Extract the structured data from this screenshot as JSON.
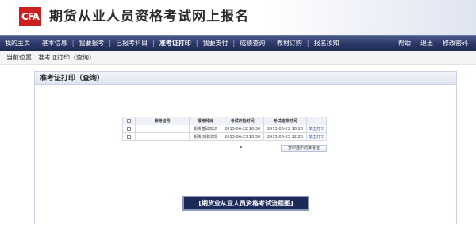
{
  "header": {
    "logo_text": "CFA",
    "title": "期货从业人员资格考试网上报名"
  },
  "nav": {
    "left": [
      "我的主页",
      "基本信息",
      "我要报考",
      "已报考科目",
      "准考证打印",
      "我要支付",
      "成绩查询",
      "教材订购",
      "报名须知"
    ],
    "active_index": 4,
    "right": [
      "帮助",
      "退出",
      "修改密码"
    ]
  },
  "breadcrumb": "当前位置：准考证打印（查询）",
  "panel": {
    "title": "准考证打印（查询）",
    "table": {
      "headers": [
        "",
        "准考证号",
        "报考科目",
        "考试开始时间",
        "考试结束时间",
        ""
      ],
      "rows": [
        {
          "ticket": "",
          "subject": "期货基础知识",
          "start": "2013-06-22 16:30",
          "end": "2013-06-22 18:20",
          "action": "单击打印"
        },
        {
          "ticket": "",
          "subject": "期货法律法规",
          "start": "2013-06-23 10:30",
          "end": "2013-06-23 12:20",
          "action": "单击打印"
        }
      ]
    },
    "print_selected_button": "打印选中的准考证",
    "flow_button": "[期货业从业人员资格考试流程图]"
  },
  "colors": {
    "nav_bg": "#2b3866",
    "logo_red": "#cc1f1f",
    "flow_button_bg": "#1c2a5a",
    "link": "#2b4c9a"
  }
}
